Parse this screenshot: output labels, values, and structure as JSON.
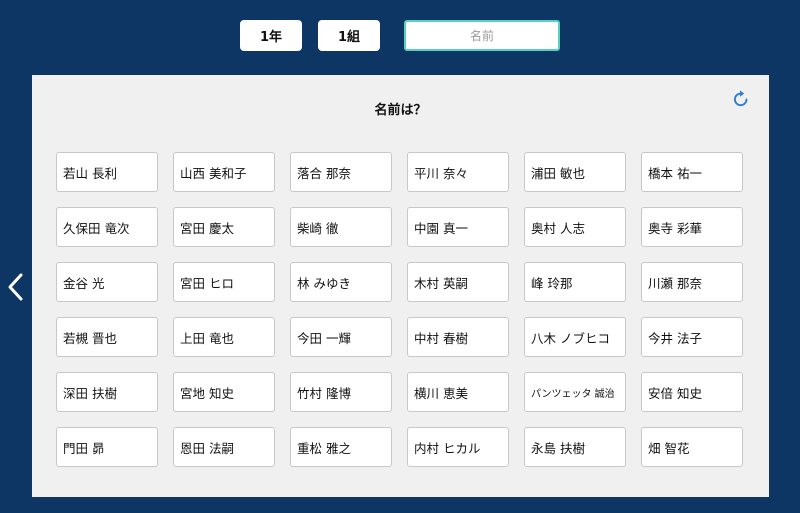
{
  "header": {
    "year_label": "1年",
    "class_label": "1組",
    "name_placeholder": "名前",
    "name_value": ""
  },
  "panel": {
    "title": "名前は？",
    "refresh_icon": "refresh-icon"
  },
  "nav": {
    "back_icon": "chevron-left-icon"
  },
  "colors": {
    "background": "#0d3665",
    "panel": "#f0f0f0",
    "input_border": "#57d0c4",
    "refresh_icon": "#2a7fd4"
  },
  "students": [
    "若山 長利",
    "山西 美和子",
    "落合 那奈",
    "平川 奈々",
    "浦田 敏也",
    "橋本 祐一",
    "久保田 竜次",
    "宮田 慶太",
    "柴崎 徹",
    "中園 真一",
    "奥村 人志",
    "奥寺 彩華",
    "金谷 光",
    "宮田 ヒロ",
    "林 みゆき",
    "木村 英嗣",
    "峰 玲那",
    "川瀬 那奈",
    "若槻 晋也",
    "上田 竜也",
    "今田 一輝",
    "中村 春樹",
    "八木 ノブヒコ",
    "今井 法子",
    "深田 扶樹",
    "宮地 知史",
    "竹村 隆博",
    "横川 恵美",
    "パンツェッタ 誠治",
    "安倍 知史",
    "門田 昴",
    "恩田 法嗣",
    "重松 雅之",
    "内村 ヒカル",
    "永島 扶樹",
    "畑 智花"
  ]
}
